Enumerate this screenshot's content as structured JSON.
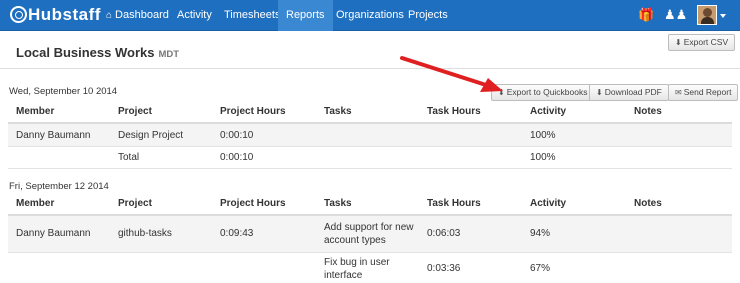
{
  "nav": {
    "brand": "Hubstaff",
    "items": [
      "Dashboard",
      "Activity",
      "Timesheets",
      "Reports",
      "Organizations",
      "Projects"
    ],
    "active": "Reports",
    "icons": [
      "home-icon",
      "gift-icon",
      "users-icon"
    ]
  },
  "header": {
    "title": "Local Business Works",
    "timezone": "MDT",
    "export_csv": "Export CSV"
  },
  "actions": {
    "export_quickbooks": "Export to Quickbooks",
    "download_pdf": "Download PDF",
    "send_report": "Send Report"
  },
  "columns": [
    "Member",
    "Project",
    "Project Hours",
    "Tasks",
    "Task Hours",
    "Activity",
    "Notes"
  ],
  "days": [
    {
      "date": "Wed, September 10 2014",
      "rows": [
        {
          "member": "Danny Baumann",
          "project": "Design Project",
          "project_hours": "0:00:10",
          "tasks": "",
          "task_hours": "",
          "activity": "100%",
          "notes": ""
        },
        {
          "member": "",
          "project": "Total",
          "project_hours": "0:00:10",
          "tasks": "",
          "task_hours": "",
          "activity": "100%",
          "notes": ""
        }
      ]
    },
    {
      "date": "Fri, September 12 2014",
      "rows": [
        {
          "member": "Danny Baumann",
          "project": "github-tasks",
          "project_hours": "0:09:43",
          "tasks": "Add support for new account types",
          "task_hours": "0:06:03",
          "activity": "94%",
          "notes": ""
        },
        {
          "member": "",
          "project": "",
          "project_hours": "",
          "tasks": "Fix bug in user interface",
          "task_hours": "0:03:36",
          "activity": "67%",
          "notes": ""
        }
      ]
    }
  ],
  "colors": {
    "nav_bg": "#1f6fc0",
    "nav_active": "#3a87d2",
    "annotation_arrow": "#e02020"
  }
}
